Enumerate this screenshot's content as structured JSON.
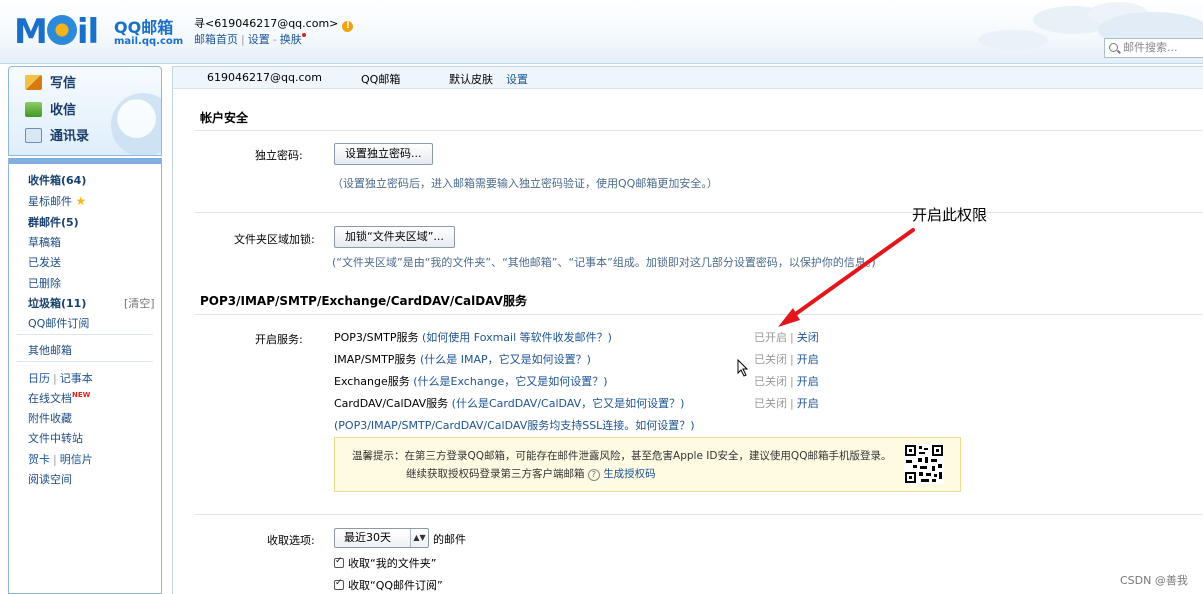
{
  "header": {
    "logo_word": "M",
    "logo_word2": "il",
    "logo_cn": "QQ邮箱",
    "logo_url": "mail.qq.com",
    "user": "寻<619046217@qq.com>",
    "warn": "!",
    "links": [
      "邮箱首页",
      "设置",
      "换肤"
    ],
    "search_placeholder": "邮件搜索..."
  },
  "quick": {
    "write": "写信",
    "inbox": "收信",
    "contacts": "通讯录"
  },
  "folders": {
    "inbox": "收件箱(64)",
    "starred": "星标邮件",
    "group": "群邮件(5)",
    "drafts": "草稿箱",
    "sent": "已发送",
    "deleted": "已删除",
    "spam": "垃圾箱(11)",
    "clear": "[清空]",
    "subscription": "QQ邮件订阅",
    "other": "其他邮箱",
    "calendar": "日历",
    "notes": "记事本",
    "docs": "在线文档",
    "new_badge": "NEW",
    "attachments": "附件收藏",
    "transfer": "文件中转站",
    "card": "贺卡",
    "postcard": "明信片",
    "reading": "阅读空间"
  },
  "account_strip": {
    "email": "619046217@qq.com",
    "tab": "QQ邮箱",
    "skin": "默认皮肤",
    "settings": "设置"
  },
  "security": {
    "title": "帐户安全",
    "pwd_label": "独立密码:",
    "pwd_button": "设置独立密码...",
    "pwd_note": "（设置独立密码后，进入邮箱需要输入独立密码验证，使用QQ邮箱更加安全。）",
    "folder_label": "文件夹区域加锁:",
    "folder_button": "加锁“文件夹区域”...",
    "folder_note": "(“文件夹区域”是由“我的文件夹”、“其他邮箱”、“记事本”组成。加锁即对这几部分设置密码，以保护你的信息。)"
  },
  "services": {
    "title": "POP3/IMAP/SMTP/Exchange/CardDAV/CalDAV服务",
    "label": "开启服务:",
    "rows": [
      {
        "name": "POP3/SMTP服务",
        "help": "(如何使用 Foxmail 等软件收发邮件？)",
        "state": "已开启",
        "action": "关闭"
      },
      {
        "name": "IMAP/SMTP服务",
        "help": "(什么是 IMAP，它又是如何设置？)",
        "state": "已关闭",
        "action": "开启"
      },
      {
        "name": "Exchange服务",
        "help": "(什么是Exchange，它又是如何设置？)",
        "state": "已关闭",
        "action": "开启"
      },
      {
        "name": "CardDAV/CalDAV服务",
        "help": "(什么是CardDAV/CalDAV，它又是如何设置？)",
        "state": "已关闭",
        "action": "开启"
      }
    ],
    "ssl_note": "(POP3/IMAP/SMTP/CardDAV/CalDAV服务均支持SSL连接。如何设置？)",
    "tip_line1": "温馨提示：在第三方登录QQ邮箱，可能存在邮件泄露风险，甚至危害Apple ID安全，建议使用QQ邮箱手机版登录。",
    "tip_line2_prefix": "继续获取授权码登录第三方客户端邮箱",
    "tip_help": "?",
    "tip_link": "生成授权码"
  },
  "receive": {
    "label": "收取选项:",
    "select_value": "最近30天",
    "suffix": "的邮件",
    "opt1": "收取“我的文件夹”",
    "opt2": "收取“QQ邮件订阅”"
  },
  "annotation": "开启此权限",
  "watermark": "CSDN @善我",
  "colors": {
    "brand": "#1a6fc7",
    "link": "#1e5494",
    "arrow": "#e3161b",
    "tip_bg": "#fffbe3"
  }
}
